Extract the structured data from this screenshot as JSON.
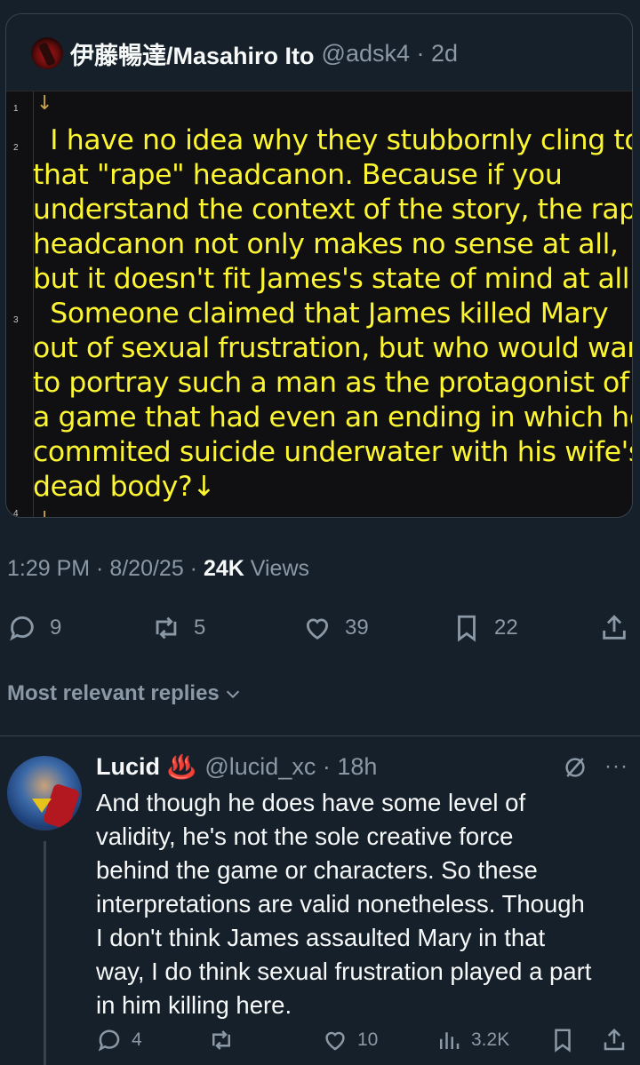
{
  "quote": {
    "author_name": "伊藤暢達/Masahiro Ito",
    "author_handle": "@adsk4 · 2d",
    "line_numbers": [
      "1",
      "2",
      "3",
      "4"
    ],
    "lines": [
      "↓",
      "  I have no idea why they stubbornly cling to",
      "that \"rape\" headcanon. Because if you",
      "understand the context of the story, the rape",
      "headcanon not only makes no sense at all,",
      "but it doesn't fit James's state of mind at all.↓",
      "  Someone claimed that James killed Mary",
      "out of sexual frustration, but who would want",
      "to portray such a man as the protagonist of",
      "a game that had even an ending in which he",
      "commited suicide underwater with his wife's",
      "dead body?↓",
      "↓"
    ]
  },
  "meta": {
    "time": "1:29 PM · 8/20/25 · ",
    "views_count": "24K",
    "views_label": " Views"
  },
  "actions": {
    "replies": "9",
    "reposts": "5",
    "likes": "39",
    "bookmarks": "22"
  },
  "sort_label": "Most relevant replies",
  "reply": {
    "name": "Lucid",
    "emoji": "♨️",
    "handle": "@lucid_xc · 18h",
    "more": "···",
    "lines": [
      "And though he does have some level of",
      "validity, he's not the sole creative force",
      "behind the game or characters. So these",
      "interpretations are valid nonetheless. Though",
      "I don't think James assaulted Mary in that",
      "way, I do think sexual frustration played a part",
      "in him killing here."
    ],
    "replies": "4",
    "reposts": "",
    "likes": "10",
    "views": "3.2K"
  },
  "colors": {
    "background": "#15202b",
    "code_background": "#100f12",
    "code_text": "#fcf532",
    "muted": "#8b98a5",
    "text": "#f7f9f9",
    "border": "#38444d"
  }
}
